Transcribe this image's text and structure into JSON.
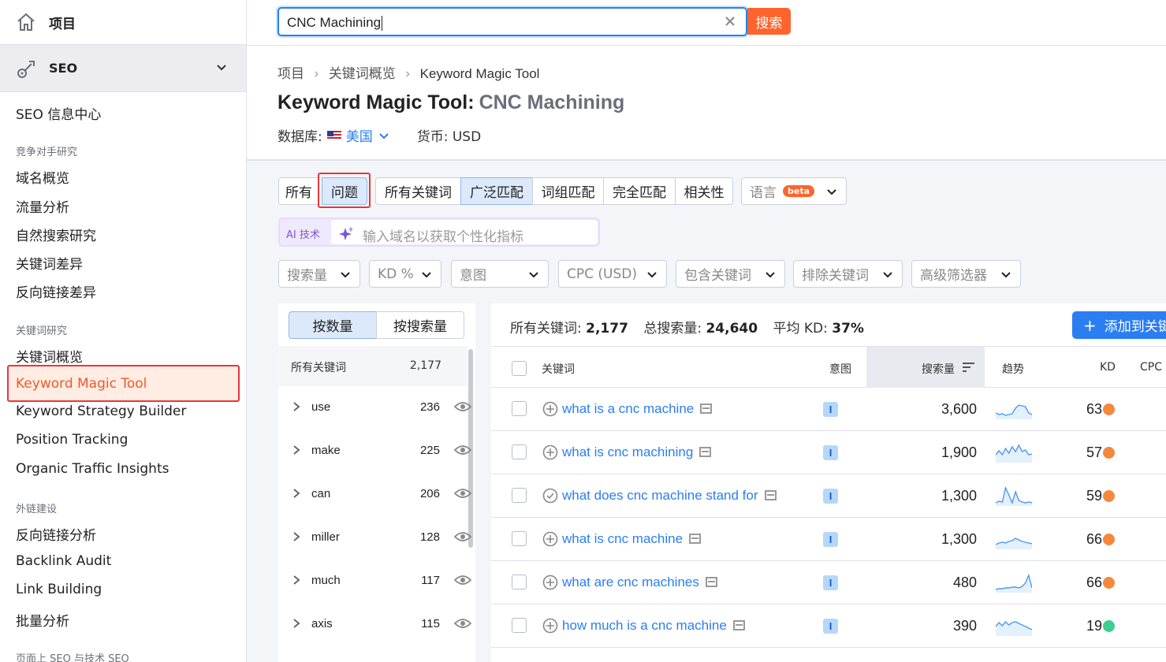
{
  "sidebar": {
    "home_label": "项目",
    "seo_label": "SEO",
    "items": [
      {
        "label": "SEO 信息中心",
        "type": "item"
      },
      {
        "label": "竞争对手研究",
        "type": "group"
      },
      {
        "label": "域名概览",
        "type": "item"
      },
      {
        "label": "流量分析",
        "type": "item"
      },
      {
        "label": "自然搜索研究",
        "type": "item"
      },
      {
        "label": "关键词差异",
        "type": "item"
      },
      {
        "label": "反向链接差异",
        "type": "item"
      },
      {
        "label": "关键词研究",
        "type": "group"
      },
      {
        "label": "关键词概览",
        "type": "item"
      },
      {
        "label": "Keyword Magic Tool",
        "type": "item",
        "active": true
      },
      {
        "label": "Keyword Strategy Builder",
        "type": "item"
      },
      {
        "label": "Position Tracking",
        "type": "item"
      },
      {
        "label": "Organic Traffic Insights",
        "type": "item"
      },
      {
        "label": "外链建设",
        "type": "group"
      },
      {
        "label": "反向链接分析",
        "type": "item"
      },
      {
        "label": "Backlink Audit",
        "type": "item"
      },
      {
        "label": "Link Building",
        "type": "item"
      },
      {
        "label": "批量分析",
        "type": "item"
      },
      {
        "label": "页面上 SEO 与技术 SEO",
        "type": "group"
      }
    ]
  },
  "search": {
    "value": "CNC Machining",
    "button": "搜索"
  },
  "breadcrumb": [
    "项目",
    "关键词概览",
    "Keyword Magic Tool"
  ],
  "page": {
    "title": "Keyword Magic Tool:",
    "query": "CNC Machining",
    "db_label": "数据库:",
    "country": "美国",
    "currency": "货币: USD"
  },
  "tabs_group1": [
    "所有",
    "问题"
  ],
  "tabs_group2": [
    "所有关键词",
    "广泛匹配",
    "词组匹配",
    "完全匹配",
    "相关性"
  ],
  "language": {
    "label": "语言",
    "badge": "beta"
  },
  "ai": {
    "label": "AI 技术",
    "placeholder": "输入域名以获取个性化指标"
  },
  "filters": [
    "搜索量",
    "KD %",
    "意图",
    "CPC (USD)",
    "包含关键词",
    "排除关键词",
    "高级筛选器"
  ],
  "groups_panel": {
    "toggle": [
      "按数量",
      "按搜索量"
    ],
    "header": {
      "label": "所有关键词",
      "count": "2,177"
    },
    "rows": [
      {
        "word": "use",
        "count": "236"
      },
      {
        "word": "make",
        "count": "225"
      },
      {
        "word": "can",
        "count": "206"
      },
      {
        "word": "miller",
        "count": "128"
      },
      {
        "word": "much",
        "count": "117"
      },
      {
        "word": "axis",
        "count": "115"
      }
    ]
  },
  "summary": {
    "all_label": "所有关键词:",
    "all_value": "2,177",
    "vol_label": "总搜索量:",
    "vol_value": "24,640",
    "kd_label": "平均 KD:",
    "kd_value": "37%"
  },
  "add_button": "添加到关键",
  "table": {
    "columns": [
      "关键词",
      "意图",
      "搜索量",
      "趋势",
      "KD",
      "CPC"
    ],
    "rows": [
      {
        "keyword": "what is a cnc machine",
        "intent": "I",
        "volume": "3,600",
        "kd": "63",
        "kd_color": "#f5883d",
        "trend": [
          18,
          20,
          19,
          21,
          20,
          19,
          12,
          8,
          9,
          10,
          18,
          20
        ]
      },
      {
        "keyword": "what is cnc machining",
        "intent": "I",
        "volume": "1,900",
        "kd": "57",
        "kd_color": "#f5883d",
        "trend": [
          16,
          11,
          16,
          8,
          14,
          6,
          12,
          4,
          12,
          10,
          16,
          15
        ]
      },
      {
        "keyword": "what does cnc machine stand for",
        "intent": "I",
        "volume": "1,300",
        "kd": "59",
        "kd_color": "#f5883d",
        "trend": [
          22,
          20,
          21,
          3,
          12,
          22,
          8,
          19,
          21,
          22,
          21,
          22
        ]
      },
      {
        "keyword": "what is cnc machine",
        "intent": "I",
        "volume": "1,300",
        "kd": "66",
        "kd_color": "#f5883d",
        "trend": [
          20,
          18,
          17,
          18,
          16,
          15,
          12,
          14,
          16,
          17,
          18,
          19
        ]
      },
      {
        "keyword": "what are cnc machines",
        "intent": "I",
        "volume": "480",
        "kd": "66",
        "kd_color": "#f5883d",
        "trend": [
          22,
          21,
          21,
          20,
          20,
          19,
          19,
          20,
          18,
          14,
          4,
          20
        ]
      },
      {
        "keyword": "how much is a cnc machine",
        "intent": "I",
        "volume": "390",
        "kd": "19",
        "kd_color": "#3ccf8e",
        "trend": [
          14,
          9,
          13,
          8,
          12,
          9,
          8,
          10,
          12,
          14,
          16,
          18
        ]
      }
    ]
  }
}
